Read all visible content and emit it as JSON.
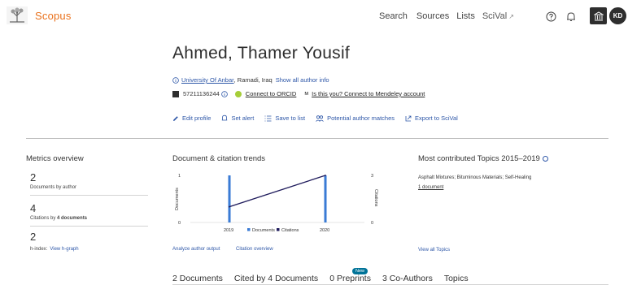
{
  "brand": {
    "name": "Scopus"
  },
  "nav": {
    "search": "Search",
    "sources": "Sources",
    "lists": "Lists",
    "scival": "SciVal",
    "scival_ext": "↗"
  },
  "user": {
    "initials": "KD"
  },
  "author": {
    "name": "Ahmed, Thamer Yousif",
    "affiliation": "University Of Anbar",
    "location": ", Ramadi, Iraq",
    "show_all": "Show all author info",
    "author_id": "57211136244",
    "connect_orcid": "Connect to ORCID",
    "mendeley": "Is this you? Connect to Mendeley account"
  },
  "actions": {
    "edit_profile": "Edit profile",
    "set_alert": "Set alert",
    "save_to_list": "Save to list",
    "potential_matches": "Potential author matches",
    "export": "Export to SciVal"
  },
  "metrics": {
    "title": "Metrics overview",
    "documents_value": "2",
    "documents_label": "Documents by author",
    "citations_value": "4",
    "citations_label_pre": "Citations by ",
    "citations_label_bold": "4 documents",
    "hindex_value": "2",
    "hindex_label": "h-index:",
    "hindex_link": "View h-graph"
  },
  "trends": {
    "title": "Document & citation trends",
    "analyze_link": "Analyze author output",
    "citation_overview_link": "Citation overview"
  },
  "chart_data": {
    "type": "bar",
    "categories": [
      "2019",
      "2020"
    ],
    "series": [
      {
        "name": "Documents",
        "type": "bar",
        "axis": "left",
        "values": [
          1,
          1
        ],
        "color": "#3a7bd5"
      },
      {
        "name": "Citations",
        "type": "line",
        "axis": "right",
        "values": [
          1,
          3
        ],
        "color": "#1f1b5c"
      }
    ],
    "ylabel_left": "Documents",
    "ylabel_right": "Citations",
    "ylim_left": [
      0,
      1
    ],
    "ylim_right": [
      0,
      3
    ],
    "left_ticks": [
      "0",
      "1"
    ],
    "right_ticks": [
      "0",
      "3"
    ],
    "legend_position": "bottom"
  },
  "topics": {
    "title": "Most contributed Topics 2015–2019",
    "topic": "Asphalt Mixtures; Bituminous Materials; Self-Healing",
    "count": "1 document",
    "view_all": "View all Topics"
  },
  "tabs": [
    {
      "label": "2 Documents"
    },
    {
      "label": "Cited by 4 Documents"
    },
    {
      "label": "0 Preprints"
    },
    {
      "label": "3 Co-Authors"
    },
    {
      "label": "Topics"
    }
  ],
  "badges": {
    "new": "New"
  }
}
